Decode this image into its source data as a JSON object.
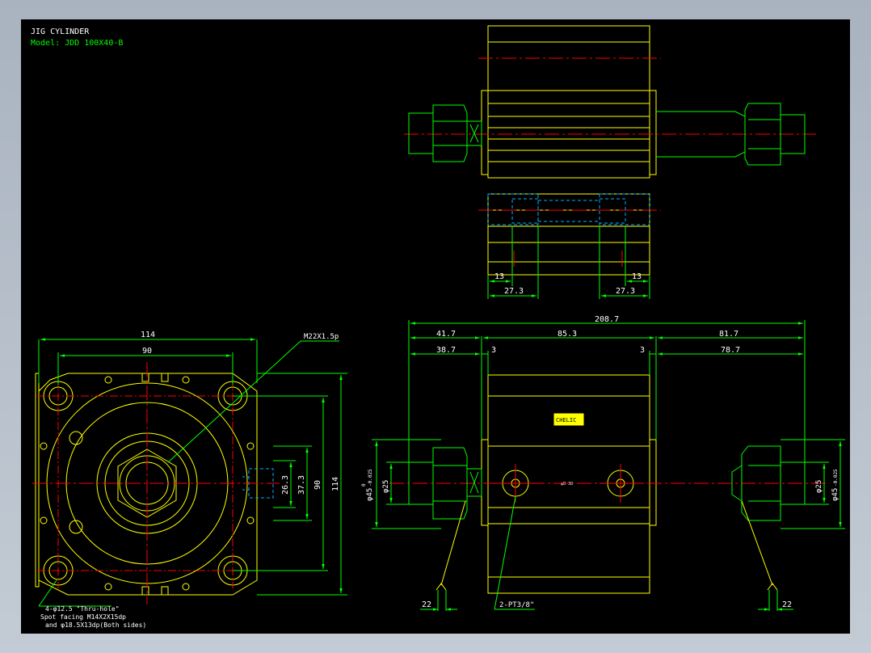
{
  "title": {
    "line1": "JIG CYLINDER",
    "line2": "Model: JDD 100X40-B"
  },
  "colors": {
    "background": "#000000",
    "frame": "#a9b3c0",
    "body_outline": "#ffff00",
    "fittings": "#00ff00",
    "dimensions": "#00ff00",
    "centerlines": "#ff0000",
    "hidden": "#00b0ff",
    "text": "#ffffff"
  },
  "front_view": {
    "dims": {
      "width_overall": "114",
      "hole_pitch_h": "90",
      "height_overall": "114",
      "hole_pitch_v": "90",
      "port_26": "26.3",
      "port_37": "37.3"
    },
    "callout_thread": "M22X1.5p",
    "note_line1": "4-φ12.5 \"Thru-hole\"",
    "note_line2": "Spot facing  M14X2X15dp",
    "note_line3": "and φ18.5X13dp(Both sides)"
  },
  "top_view": {
    "dims": {
      "left_13": "13",
      "left_27": "27.3",
      "right_13": "13",
      "right_27": "27.3"
    }
  },
  "side_view": {
    "dims": {
      "overall": "208.7",
      "left_ext": "41.7",
      "body": "85.3",
      "right_ext": "81.7",
      "left_rod": "38.7",
      "gap_left": "3",
      "gap_right": "3",
      "right_rod": "78.7",
      "dia_left_45": "φ45",
      "dia_left_25": "φ25",
      "dia_right_25": "φ25",
      "dia_right_45": "φ45",
      "tol": "-0.025",
      "tol_top": "0",
      "bottom_left_22": "22",
      "bottom_right_22": "22"
    },
    "port_note": "2-PT3/8\"",
    "label_plate": "CHELIC",
    "tiny_label": "φB 38"
  }
}
